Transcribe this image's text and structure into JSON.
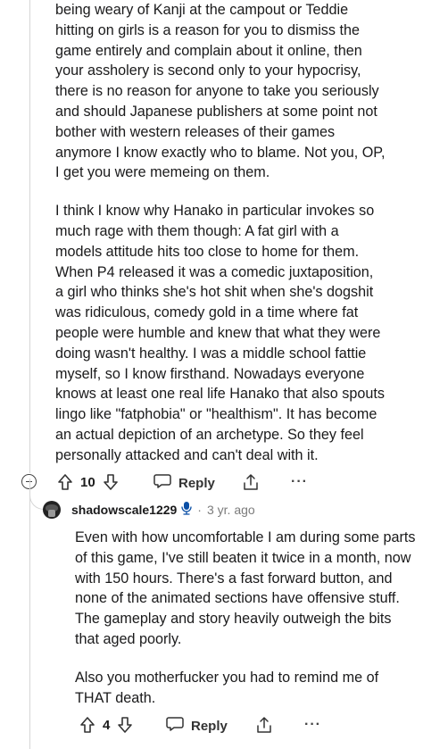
{
  "comment1": {
    "paragraphs": [
      "being weary of Kanji at the campout or Teddie\nhitting on girls is a reason for you to dismiss the\ngame entirely and complain about it online, then\nyour assholery is second only to your hypocrisy,\nthere is no reason for anyone to take you seriously\nand should Japanese publishers at some point not\nbother with western releases of their games\nanymore I know exactly who to blame. Not you, OP,\nI get you were memeing on them.",
      "I think I know why Hanako in particular invokes so\nmuch rage with them though: A fat girl with a\nmodels attitude hits too close to home for them.\nWhen P4 released it was a comedic juxtaposition,\na girl who thinks she's hot shit when she's dogshit\nwas ridiculous, comedy gold in a time where fat\npeople were humble and knew that what they were\ndoing wasn't healthy. I was a middle school fattie\nmyself, so I know firsthand. Nowadays everyone\nknows at least one real life Hanako that also spouts\nlingo like \"fatphobia\" or \"healthism\". It has become\nan actual depiction of an archetype. So they feel\npersonally attacked and can't deal with it."
    ],
    "vote_count": "10",
    "reply_label": "Reply",
    "more_label": "···"
  },
  "comment2": {
    "username": "shadowscale1229",
    "separator": "·",
    "age": "3 yr. ago",
    "paragraphs": [
      "Even with how uncomfortable I am during some parts of this game, I've still beaten it twice in a month, now with 150 hours. There's a fast forward button, and none of the animated sections have offensive stuff. The gameplay and story heavily outweigh the bits that aged poorly.",
      "Also you motherfucker you had to remind me of THAT death."
    ],
    "vote_count": "4",
    "reply_label": "Reply",
    "more_label": "···"
  }
}
